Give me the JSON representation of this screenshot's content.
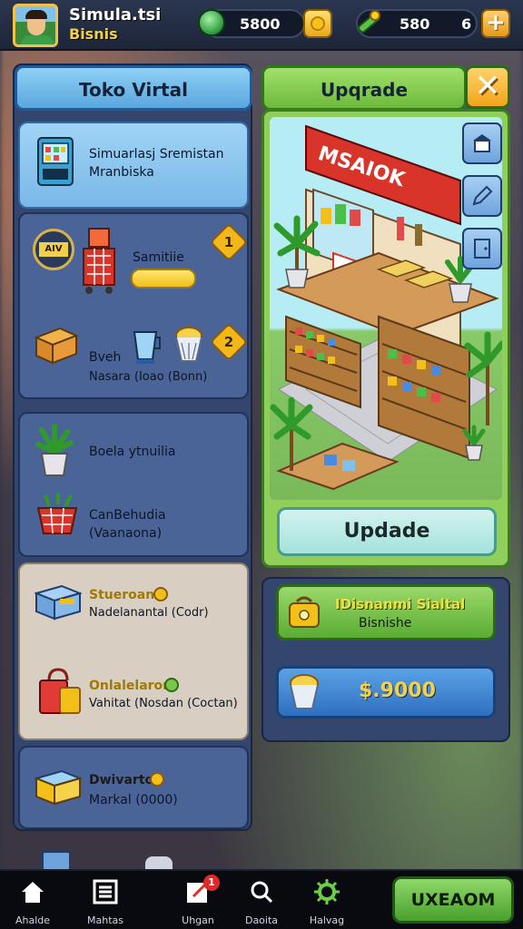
{
  "header": {
    "title": "Simula.tsi",
    "subtitle": "Bisnis",
    "gems": "5800",
    "energy": "580",
    "lives": "6"
  },
  "left_panel": {
    "title": "Toko Virtal",
    "card1": {
      "line1": "Simuarlasj Sremistan",
      "line2": "Mranbiska"
    },
    "card2": {
      "sign": "AIV",
      "item1_label": "Samitiie",
      "item1_badge": "1",
      "item1_progress": 0.6,
      "item2_label": "Bveh",
      "item2_sub": "Nasara (Ioao (Bonn)",
      "item2_badge": "2"
    },
    "card3": {
      "item1_label": "Boela ytnuilia",
      "item2_line1": "CanBehudia",
      "item2_line2": "(Vaanaona)"
    },
    "card4": {
      "item1_title": "Stueroan",
      "item1_sub": "Nadelanantal (Codr)",
      "item2_title": "Onlalelaron",
      "item2_sub": "Vahitat (Nosdan (Coctan)"
    },
    "card5": {
      "item1_title": "Dwivarton",
      "item1_sub": "Markal (0000)"
    }
  },
  "right_panel": {
    "title": "Upqrade",
    "close_label": "✕",
    "store_sign": "MSAIOK",
    "update_label": "Updade",
    "green_line1": "IDisnanmi Sialtal",
    "green_line2": "Bisnishe",
    "money_value": "$.9000"
  },
  "bottom_nav": {
    "items": [
      {
        "label": "Ahalde",
        "icon": "home-icon"
      },
      {
        "label": "Mahtas",
        "icon": "list-icon"
      },
      {
        "label": "Uhgan",
        "icon": "edit-icon",
        "badge": "1"
      },
      {
        "label": "Daoita",
        "icon": "search-icon"
      },
      {
        "label": "Halvag",
        "icon": "gear-icon"
      }
    ],
    "cta_label": "UXEAOM"
  },
  "colors": {
    "accent_green": "#6cba3c",
    "accent_blue": "#5aa6de",
    "panel_bg": "#34466e",
    "gold": "#f2c019"
  }
}
